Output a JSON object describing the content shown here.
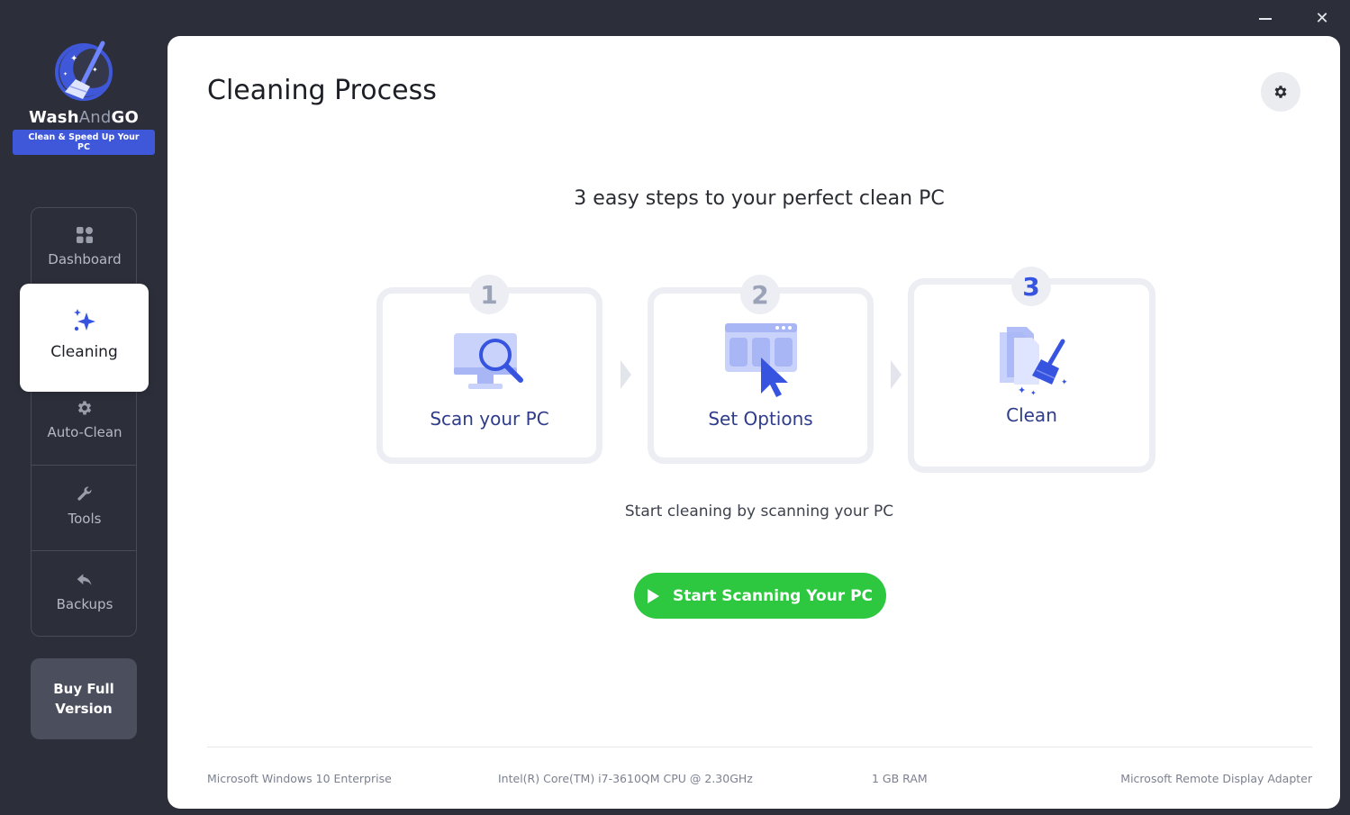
{
  "window": {
    "minimize_icon": "minimize-icon",
    "close_icon": "close-icon",
    "close_glyph": "✕"
  },
  "brand": {
    "name_part1": "Wash",
    "name_part2": "And",
    "name_part3": "GO",
    "tagline": "Clean & Speed Up Your PC",
    "logo_icon": "broom-moon-logo"
  },
  "sidebar": {
    "items": [
      {
        "label": "Dashboard",
        "icon": "grid-icon"
      },
      {
        "label": "Cleaning",
        "icon": "sparkle-icon",
        "active": true
      },
      {
        "label": "Auto-Clean",
        "icon": "gear-icon"
      },
      {
        "label": "Tools",
        "icon": "wrench-icon"
      },
      {
        "label": "Backups",
        "icon": "undo-arrow-icon"
      }
    ],
    "buy_label": "Buy Full Version"
  },
  "main": {
    "title": "Cleaning Process",
    "settings_icon": "gear-icon",
    "subtitle": "3 easy steps to your perfect clean PC",
    "steps": [
      {
        "number": "1",
        "label": "Scan your PC",
        "icon": "monitor-magnifier-icon"
      },
      {
        "number": "2",
        "label": "Set Options",
        "icon": "window-cursor-icon",
        "active": false
      },
      {
        "number": "3",
        "label": "Clean",
        "icon": "files-broom-icon",
        "active": true
      }
    ],
    "hint": "Start cleaning by scanning your PC",
    "start_button": "Start Scanning Your PC"
  },
  "sysinfo": {
    "os": "Microsoft Windows 10 Enterprise",
    "cpu": "Intel(R) Core(TM) i7-3610QM CPU @ 2.30GHz",
    "ram": "1 GB RAM",
    "gpu": "Microsoft Remote Display Adapter"
  },
  "colors": {
    "background": "#2c2f3a",
    "panel": "#ffffff",
    "accent_blue": "#3654e0",
    "start_green": "#2ec840",
    "step_label": "#2f3c8a"
  }
}
